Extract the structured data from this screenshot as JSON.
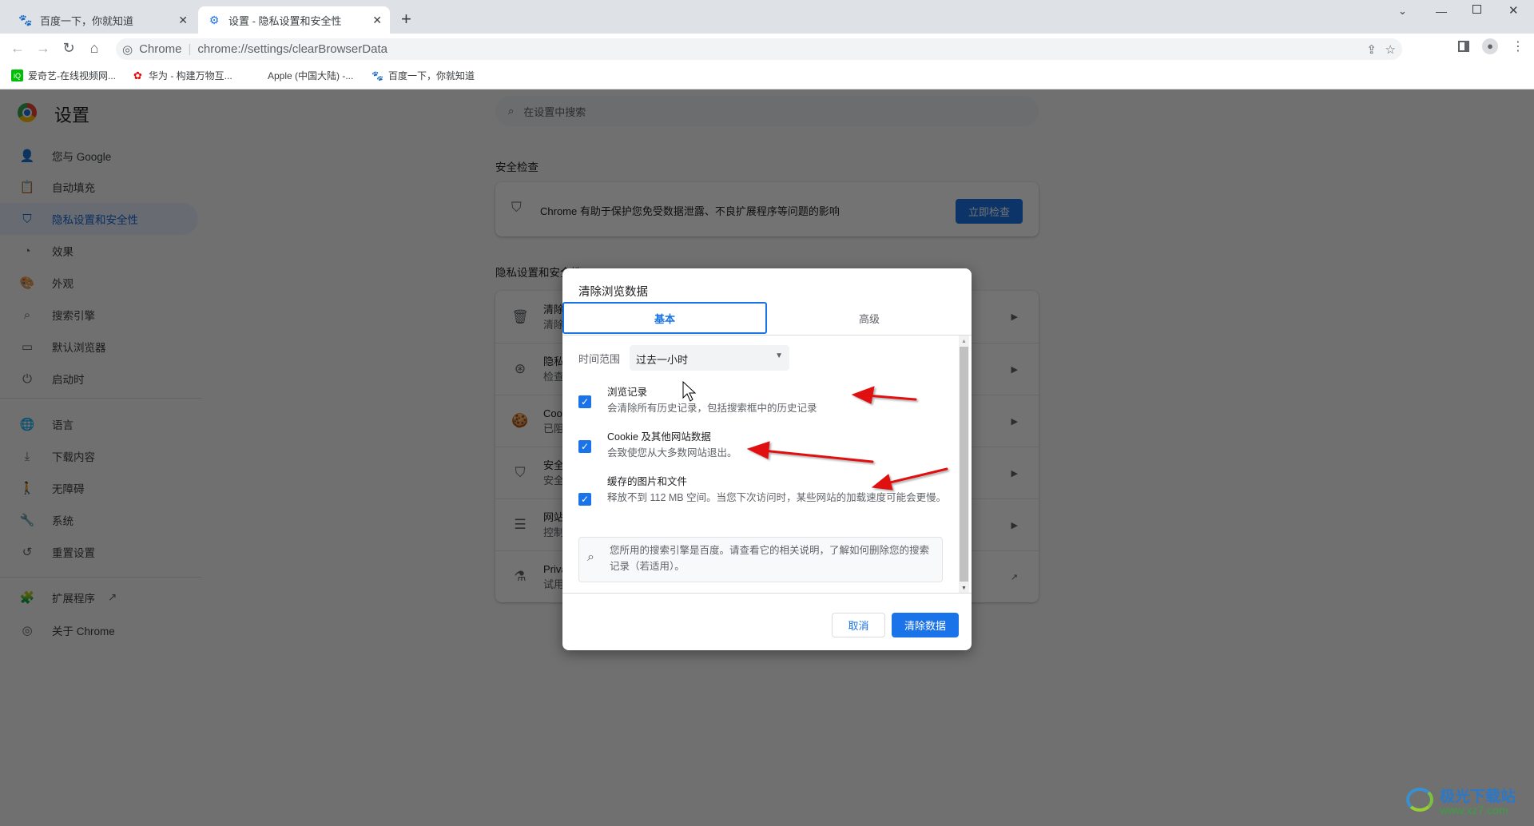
{
  "browser": {
    "tabs": [
      {
        "title": "百度一下，你就知道",
        "icon": "baidu-paw-icon"
      },
      {
        "title": "设置 - 隐私设置和安全性",
        "icon": "gear-icon"
      }
    ],
    "new_tab": "+",
    "omnibox": {
      "site_label": "Chrome",
      "url": "chrome://settings/clearBrowserData"
    },
    "bookmarks": [
      {
        "label": "爱奇艺-在线视频网...",
        "icon": "iqiyi-icon"
      },
      {
        "label": "华为 - 构建万物互...",
        "icon": "huawei-icon"
      },
      {
        "label": "Apple (中国大陆) -...",
        "icon": "apple-icon"
      },
      {
        "label": "百度一下，你就知道",
        "icon": "baidu-paw-icon"
      }
    ]
  },
  "settings": {
    "title": "设置",
    "search_placeholder": "在设置中搜索",
    "sidebar": [
      {
        "label": "您与 Google",
        "icon": "person-icon"
      },
      {
        "label": "自动填充",
        "icon": "clipboard-icon"
      },
      {
        "label": "隐私设置和安全性",
        "icon": "shield-icon",
        "active": true
      },
      {
        "label": "效果",
        "icon": "speedometer-icon"
      },
      {
        "label": "外观",
        "icon": "palette-icon"
      },
      {
        "label": "搜索引擎",
        "icon": "search-icon"
      },
      {
        "label": "默认浏览器",
        "icon": "browser-icon"
      },
      {
        "label": "启动时",
        "icon": "power-icon"
      },
      {
        "label": "语言",
        "icon": "globe-icon"
      },
      {
        "label": "下载内容",
        "icon": "download-icon"
      },
      {
        "label": "无障碍",
        "icon": "accessibility-icon"
      },
      {
        "label": "系统",
        "icon": "wrench-icon"
      },
      {
        "label": "重置设置",
        "icon": "history-icon"
      },
      {
        "label": "扩展程序",
        "icon": "puzzle-icon"
      },
      {
        "label": "关于 Chrome",
        "icon": "chrome-icon"
      }
    ],
    "safety_check": {
      "heading": "安全检查",
      "text": "Chrome 有助于保护您免受数据泄露、不良扩展程序等问题的影响",
      "button": "立即检查"
    },
    "privacy": {
      "heading": "隐私设置和安全性",
      "rows": [
        {
          "title": "清除",
          "sub": "清除",
          "icon": "trash-icon"
        },
        {
          "title": "隐私",
          "sub": "检查",
          "icon": "privacy-guide-icon"
        },
        {
          "title": "Cook",
          "sub": "已阻",
          "icon": "cookie-icon"
        },
        {
          "title": "安全",
          "sub": "安全",
          "icon": "shield-icon"
        },
        {
          "title": "网站",
          "sub": "控制",
          "icon": "sliders-icon"
        },
        {
          "title": "Priva",
          "sub": "试用",
          "icon": "flask-icon"
        }
      ]
    }
  },
  "dialog": {
    "title": "清除浏览数据",
    "tabs": [
      {
        "label": "基本",
        "active": true
      },
      {
        "label": "高级"
      }
    ],
    "time_range_label": "时间范围",
    "time_range_value": "过去一小时",
    "options": [
      {
        "title": "浏览记录",
        "desc": "会清除所有历史记录，包括搜索框中的历史记录",
        "checked": true
      },
      {
        "title": "Cookie 及其他网站数据",
        "desc": "会致使您从大多数网站退出。",
        "checked": true
      },
      {
        "title": "缓存的图片和文件",
        "desc": "释放不到 112 MB 空间。当您下次访问时，某些网站的加载速度可能会更慢。",
        "checked": true
      }
    ],
    "info": "您所用的搜索引擎是百度。请查看它的相关说明，了解如何删除您的搜索记录（若适用）。",
    "cancel": "取消",
    "confirm": "清除数据"
  },
  "watermark": {
    "name": "极光下载站",
    "url": "www.xz7.com"
  },
  "colors": {
    "accent": "#1a73e8",
    "annotation_arrow": "#e01010"
  }
}
